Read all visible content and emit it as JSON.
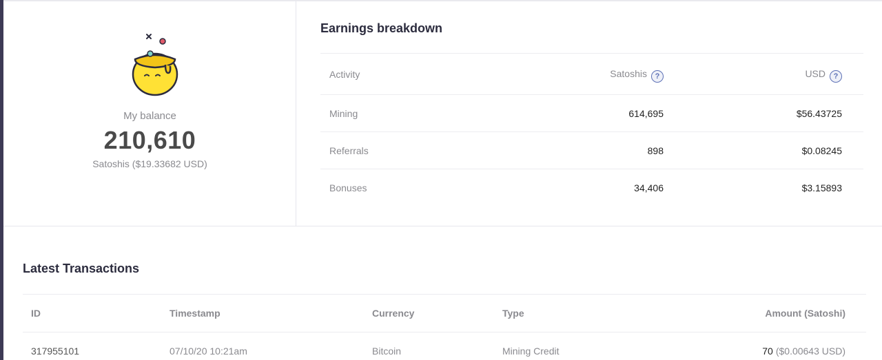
{
  "balance": {
    "label": "My balance",
    "value": "210,610",
    "sub": "Satoshis ($19.33682 USD)"
  },
  "earnings": {
    "title": "Earnings breakdown",
    "columns": {
      "activity": "Activity",
      "satoshis": "Satoshis",
      "usd": "USD"
    },
    "help_icon": "question-circle-icon",
    "rows": [
      {
        "activity": "Mining",
        "satoshis": "614,695",
        "usd": "$56.43725"
      },
      {
        "activity": "Referrals",
        "satoshis": "898",
        "usd": "$0.08245"
      },
      {
        "activity": "Bonuses",
        "satoshis": "34,406",
        "usd": "$3.15893"
      }
    ]
  },
  "transactions": {
    "title": "Latest Transactions",
    "columns": {
      "id": "ID",
      "timestamp": "Timestamp",
      "currency": "Currency",
      "type": "Type",
      "amount": "Amount (Satoshi)"
    },
    "rows": [
      {
        "id": "317955101",
        "timestamp": "07/10/20 10:21am",
        "currency": "Bitcoin",
        "type": "Mining Credit",
        "amount": "70",
        "amount_usd": "($0.00643 USD)"
      }
    ]
  },
  "colors": {
    "accent": "#3d3a55",
    "help_icon": "#5b6fb5",
    "pot": "#ffe135"
  }
}
